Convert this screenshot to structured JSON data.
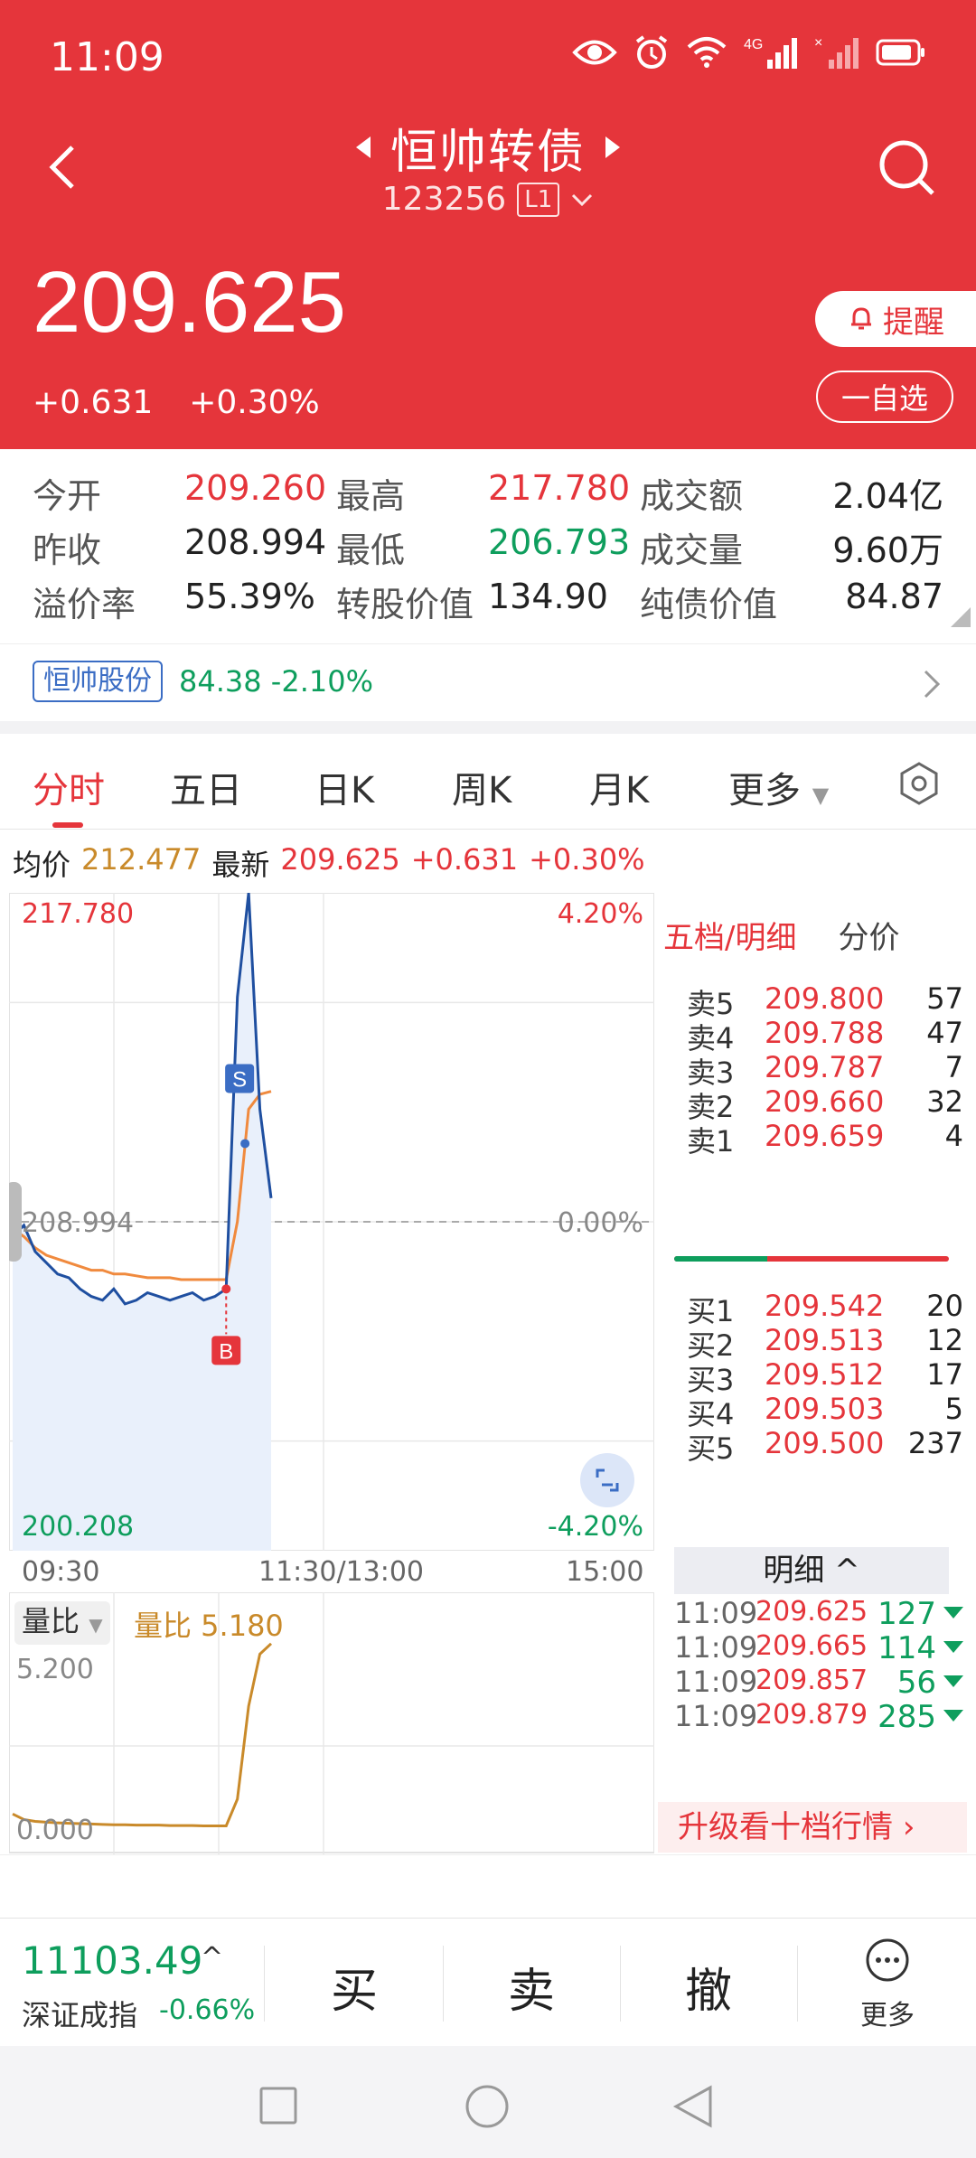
{
  "status": {
    "time": "11:09"
  },
  "header": {
    "title": "恒帅转债",
    "code": "123256",
    "level": "L1",
    "price": "209.625",
    "change": "+0.631",
    "change_pct": "+0.30%",
    "remind_label": "提醒",
    "fav_label": "一自选"
  },
  "stats": {
    "open_label": "今开",
    "open": "209.260",
    "high_label": "最高",
    "high": "217.780",
    "turnover_label": "成交额",
    "turnover": "2.04亿",
    "prev_close_label": "昨收",
    "prev_close": "208.994",
    "low_label": "最低",
    "low": "206.793",
    "volume_label": "成交量",
    "volume": "9.60万",
    "premium_label": "溢价率",
    "premium": "55.39%",
    "conv_value_label": "转股价值",
    "conv_value": "134.90",
    "bond_value_label": "纯债价值",
    "bond_value": "84.87"
  },
  "underlying": {
    "name": "恒帅股份",
    "price_change": "84.38 -2.10%"
  },
  "tabs": [
    "分时",
    "五日",
    "日K",
    "周K",
    "月K",
    "更多"
  ],
  "info_line": {
    "avg_label": "均价",
    "avg": "212.477",
    "latest_label": "最新",
    "latest": "209.625",
    "change": "+0.631",
    "change_pct": "+0.30%"
  },
  "chart_labels": {
    "y_top": "217.780",
    "y_mid": "208.994",
    "y_bottom": "200.208",
    "pct_top": "4.20%",
    "pct_mid": "0.00%",
    "pct_bottom": "-4.20%",
    "t_start": "09:30",
    "t_mid": "11:30/13:00",
    "t_end": "15:00",
    "marker_buy": "B",
    "marker_sell": "S"
  },
  "volume_ratio": {
    "tag": "量比",
    "label": "量比 5.180",
    "top": "5.200",
    "bottom": "0.000"
  },
  "orderbook": {
    "tab_active": "五档/明细",
    "tab_other": "分价",
    "asks": [
      {
        "label": "卖5",
        "price": "209.800",
        "qty": "57"
      },
      {
        "label": "卖4",
        "price": "209.788",
        "qty": "47"
      },
      {
        "label": "卖3",
        "price": "209.787",
        "qty": "7"
      },
      {
        "label": "卖2",
        "price": "209.660",
        "qty": "32"
      },
      {
        "label": "卖1",
        "price": "209.659",
        "qty": "4"
      }
    ],
    "bids": [
      {
        "label": "买1",
        "price": "209.542",
        "qty": "20"
      },
      {
        "label": "买2",
        "price": "209.513",
        "qty": "12"
      },
      {
        "label": "买3",
        "price": "209.512",
        "qty": "17"
      },
      {
        "label": "买4",
        "price": "209.503",
        "qty": "5"
      },
      {
        "label": "买5",
        "price": "209.500",
        "qty": "237"
      }
    ],
    "detail_label": "明细 ^",
    "trades": [
      {
        "time": "11:09",
        "price": "209.625",
        "vol": "127"
      },
      {
        "time": "11:09",
        "price": "209.665",
        "vol": "114"
      },
      {
        "time": "11:09",
        "price": "209.857",
        "vol": "56"
      },
      {
        "time": "11:09",
        "price": "209.879",
        "vol": "285"
      }
    ],
    "upgrade_label": "升级看十档行情"
  },
  "bottom": {
    "index_value": "11103.49",
    "index_name": "深证成指",
    "index_change": "-0.66%",
    "buy": "买",
    "sell": "卖",
    "cancel": "撤",
    "more": "更多"
  },
  "chart_data": {
    "type": "line",
    "title": "",
    "xlabel": "",
    "ylabel": "",
    "x": [
      "09:30",
      "11:30/13:00",
      "15:00"
    ],
    "ylim": [
      200.208,
      217.78
    ],
    "prev_close": 208.994,
    "series": [
      {
        "name": "",
        "color": "#1f4fa0",
        "values": [
          208.6,
          208.9,
          208.2,
          207.9,
          207.6,
          207.5,
          207.2,
          207.0,
          206.9,
          207.2,
          206.8,
          206.9,
          207.1,
          207.0,
          206.9,
          207.0,
          207.1,
          206.9,
          207.0,
          207.2,
          215.0,
          217.78,
          212.0,
          209.625
        ]
      },
      {
        "name": "",
        "color": "#f08a3e",
        "values": [
          208.8,
          208.6,
          208.3,
          208.1,
          208.0,
          207.9,
          207.8,
          207.7,
          207.7,
          207.6,
          207.6,
          207.55,
          207.5,
          207.5,
          207.5,
          207.45,
          207.45,
          207.45,
          207.45,
          207.45,
          209.0,
          212.0,
          212.4,
          212.477
        ]
      }
    ],
    "volume_ratio": {
      "ylim": [
        0,
        5.2
      ],
      "values": [
        0.6,
        0.45,
        0.4,
        0.38,
        0.36,
        0.35,
        0.34,
        0.33,
        0.32,
        0.31,
        0.31,
        0.3,
        0.3,
        0.3,
        0.29,
        0.29,
        0.29,
        0.28,
        0.28,
        0.28,
        1.0,
        3.5,
        4.9,
        5.18
      ]
    }
  }
}
